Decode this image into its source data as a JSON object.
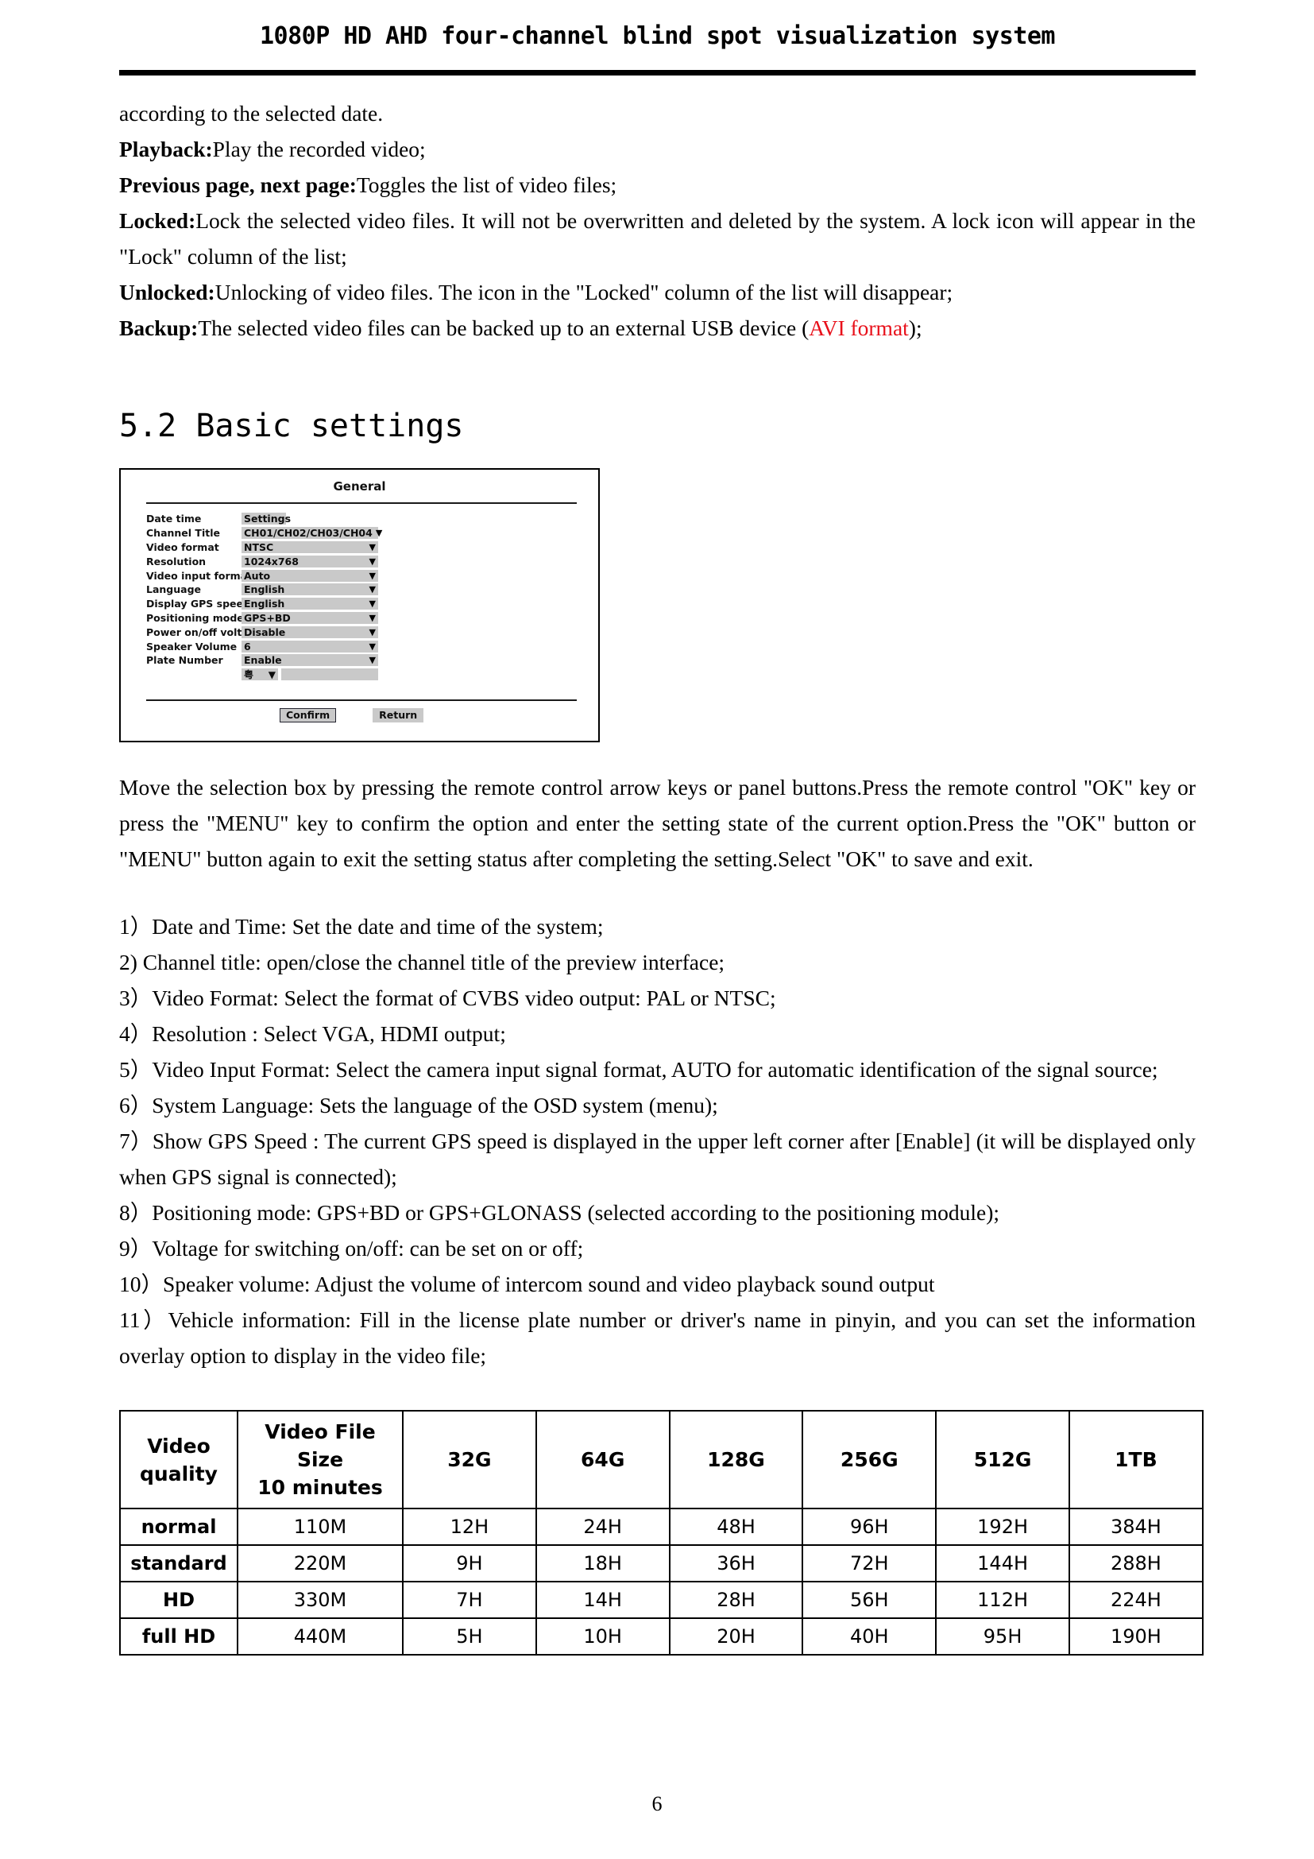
{
  "header": {
    "title": "1080P HD AHD four-channel blind spot visualization system"
  },
  "intro": {
    "line_continuation": "according to the selected date.",
    "items": [
      {
        "term": "Playback:",
        "text": "Play the recorded video;"
      },
      {
        "term": "Previous page, next page:",
        "text": "Toggles the list of video files;"
      },
      {
        "term": "Locked:",
        "text": "Lock the selected video files. It will not be overwritten and deleted by the system. A lock icon will appear in the \"Lock\" column of the list;"
      },
      {
        "term": "Unlocked:",
        "text": "Unlocking of video files. The icon in the \"Locked\" column of the list will disappear;"
      }
    ],
    "backup": {
      "term": "Backup:",
      "text_before": "The selected video files can be backed up to an external USB device (",
      "highlight": "AVI format",
      "highlight_color": "#e8101a",
      "text_after": ");"
    }
  },
  "section": {
    "heading": "5.2 Basic settings"
  },
  "osd": {
    "title": "General",
    "rows": [
      {
        "label": "Date time",
        "value": "Settings",
        "width": "short",
        "caret": false
      },
      {
        "label": "Channel Title",
        "value": "CH01/CH02/CH03/CH04",
        "width": "long",
        "caret": true
      },
      {
        "label": "Video format",
        "value": "NTSC",
        "width": "long",
        "caret": true
      },
      {
        "label": "Resolution",
        "value": "1024x768",
        "width": "long",
        "caret": true
      },
      {
        "label": "Video input format",
        "value": "Auto",
        "width": "long",
        "caret": true
      },
      {
        "label": "Language",
        "value": "English",
        "width": "long",
        "caret": true
      },
      {
        "label": "Display GPS speed",
        "value": "English",
        "width": "long",
        "caret": true
      },
      {
        "label": "Positioning mode",
        "value": "GPS+BD",
        "width": "long",
        "caret": true
      },
      {
        "label": "Power on/off voltage",
        "value": "Disable",
        "width": "long",
        "caret": true
      },
      {
        "label": "Speaker Volume",
        "value": "6",
        "width": "long",
        "caret": true
      },
      {
        "label": "Plate Number",
        "value": "Enable",
        "width": "long",
        "caret": true
      }
    ],
    "plate_row": {
      "prefix": "粤",
      "caret": "▼",
      "input_value": ""
    },
    "caret_glyph": "▼",
    "buttons": {
      "confirm": "Confirm",
      "return": "Return"
    }
  },
  "operation_para": "Move the selection box by pressing the remote control arrow keys or panel buttons.Press the remote control \"OK\" key or press the \"MENU\" key to confirm the option and enter the setting state of the current option.Press the \"OK\" button or \"MENU\" button again to exit the setting status after completing the setting.Select \"OK\" to save and exit.",
  "numbered_list": [
    "1）Date and Time: Set the date and time of the system;",
    "2) Channel title: open/close the channel title of the preview interface;",
    "3）Video Format: Select the format of CVBS video output: PAL or NTSC;",
    "4）Resolution : Select VGA, HDMI output;",
    "5）Video Input Format: Select the camera input signal format, AUTO for automatic identification of the signal source;",
    "6）System Language: Sets the language of the OSD system (menu);",
    "7）Show GPS Speed : The current GPS speed is displayed in the upper left corner after [Enable] (it will be displayed only when GPS signal is connected);",
    "8）Positioning mode: GPS+BD or GPS+GLONASS (selected according to the positioning module);",
    "9）Voltage for switching on/off: can be set on or off;",
    "10）Speaker volume: Adjust the volume of intercom sound and video playback sound output",
    "11）Vehicle information: Fill in the license plate number or driver's name in pinyin, and you can set the information overlay option to display in the video file;"
  ],
  "spec_table": {
    "headers": [
      "Video quality",
      "Video File Size 10 minutes",
      "32G",
      "64G",
      "128G",
      "256G",
      "512G",
      "1TB"
    ],
    "header_line1": [
      "Video",
      "Video File Size",
      "32G",
      "64G",
      "128G",
      "256G",
      "512G",
      "1TB"
    ],
    "header_line2": [
      "quality",
      "10 minutes",
      "",
      "",
      "",
      "",
      "",
      ""
    ],
    "rows": [
      {
        "quality": "normal",
        "file_size": "110M",
        "capacities": [
          "12H",
          "24H",
          "48H",
          "96H",
          "192H",
          "384H"
        ]
      },
      {
        "quality": "standard",
        "file_size": "220M",
        "capacities": [
          "9H",
          "18H",
          "36H",
          "72H",
          "144H",
          "288H"
        ]
      },
      {
        "quality": "HD",
        "file_size": "330M",
        "capacities": [
          "7H",
          "14H",
          "28H",
          "56H",
          "112H",
          "224H"
        ]
      },
      {
        "quality": "full HD",
        "file_size": "440M",
        "capacities": [
          "5H",
          "10H",
          "20H",
          "40H",
          "95H",
          "190H"
        ]
      }
    ]
  },
  "footer": {
    "page_number": "6"
  }
}
